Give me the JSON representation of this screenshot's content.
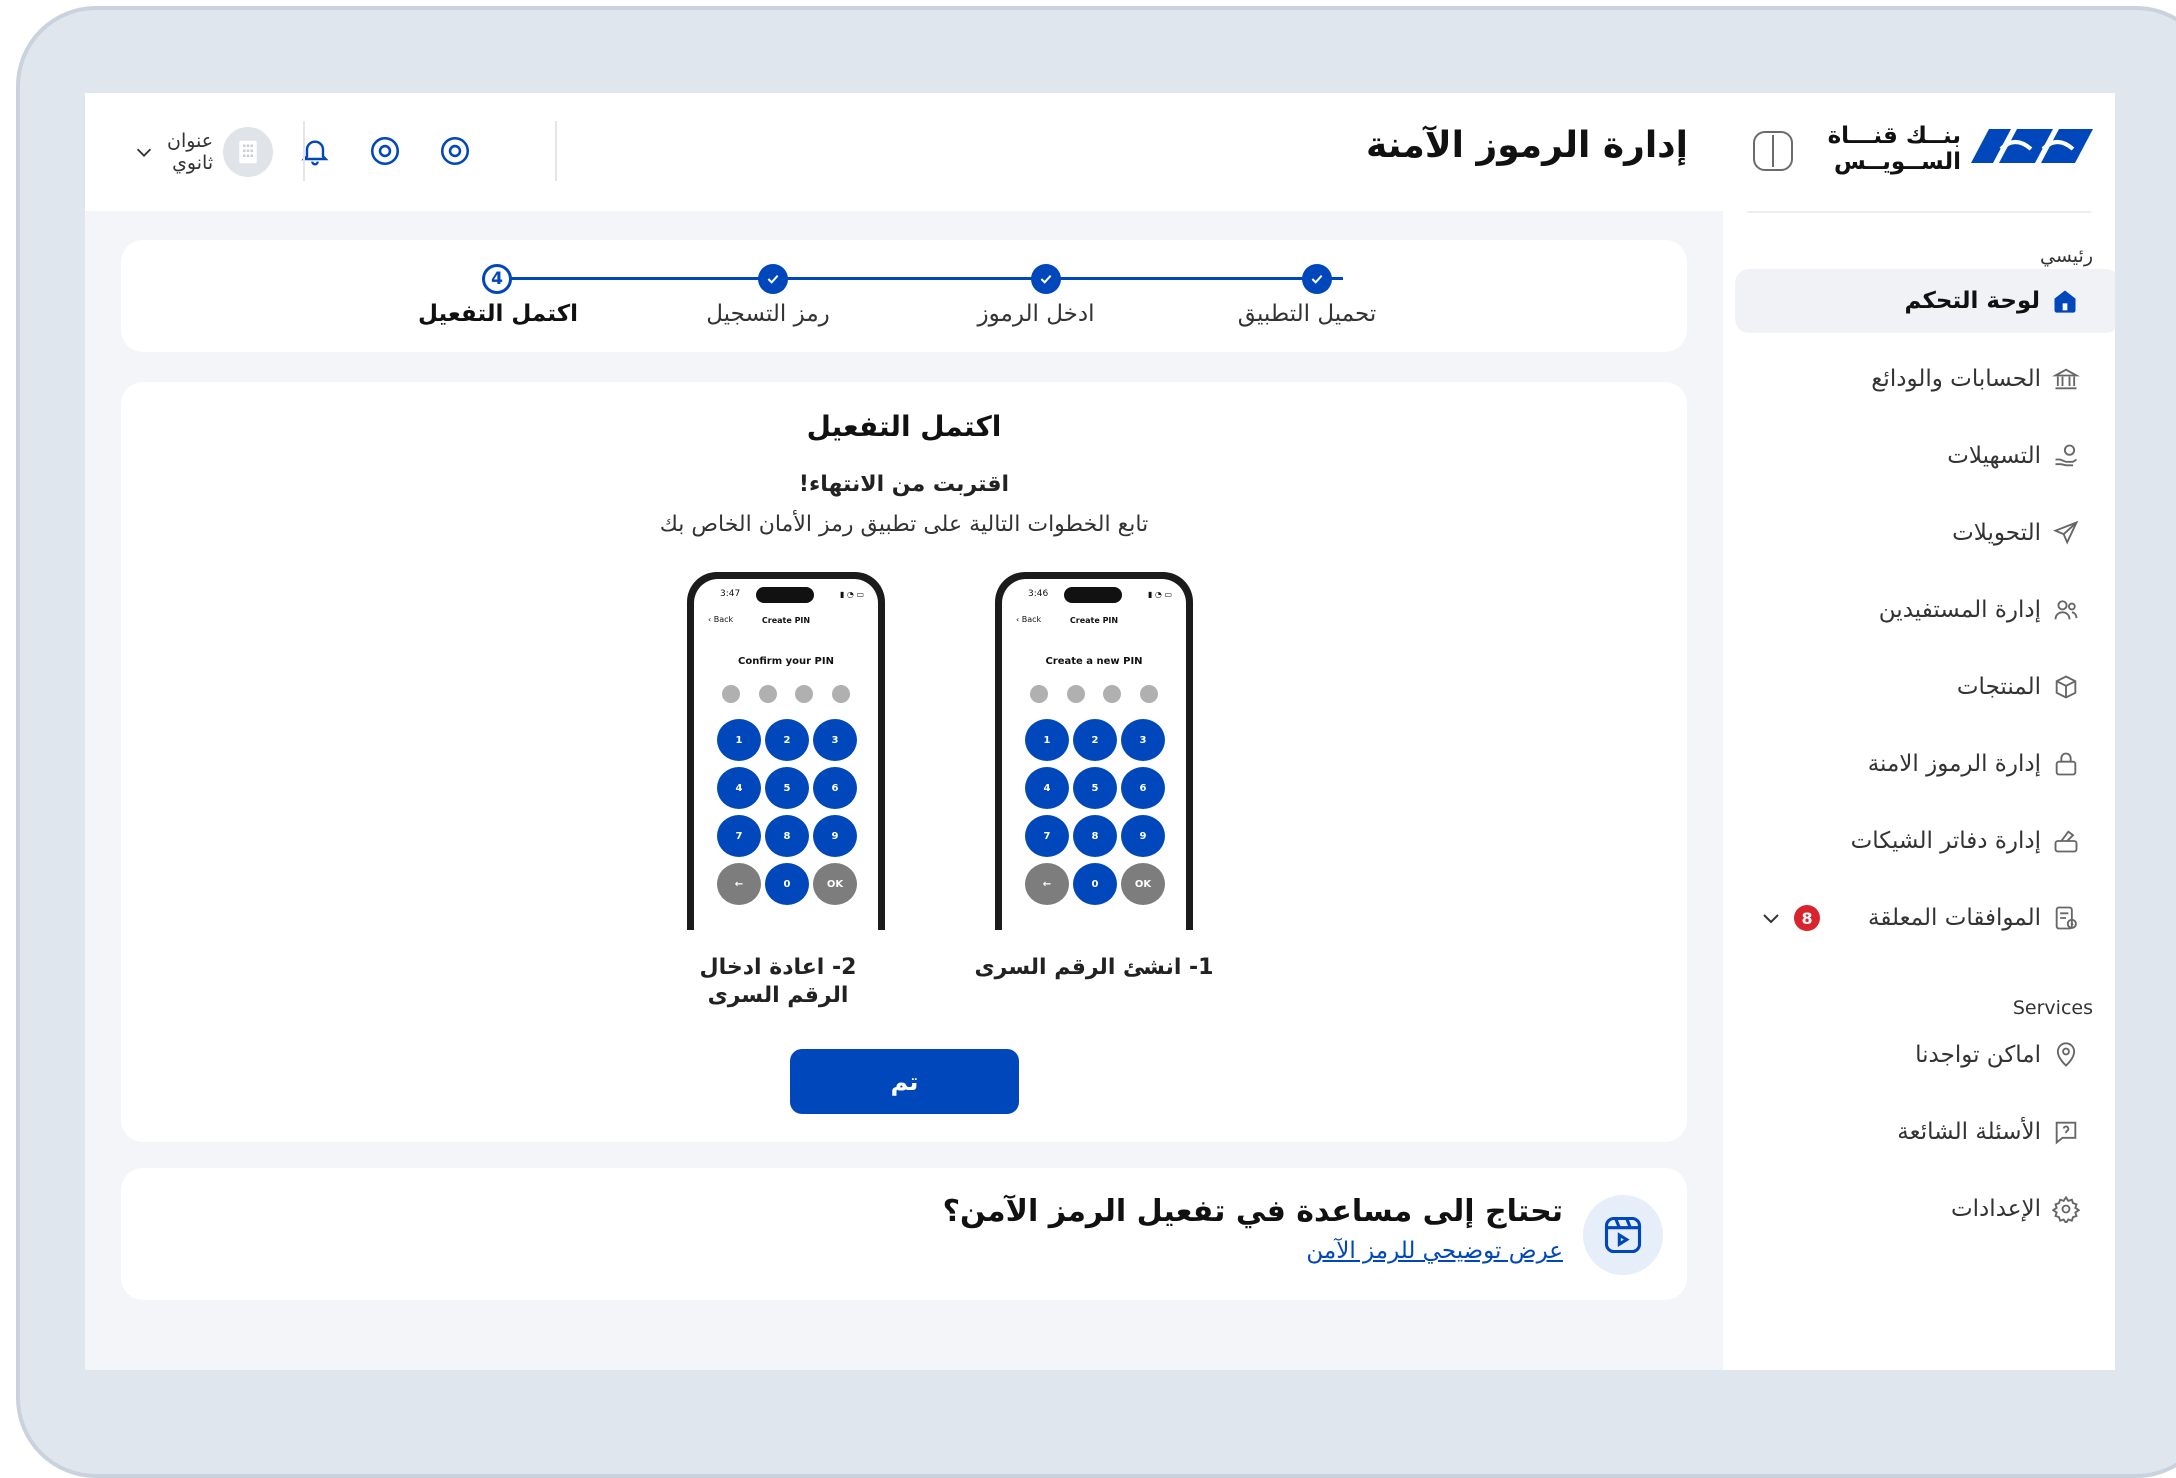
{
  "colors": {
    "primary": "#0047bb",
    "badge": "#d9232d",
    "background": "#f4f5f8",
    "frame": "#dfe6ee"
  },
  "header": {
    "brand_line1": "بنــك قنـــاة",
    "brand_line2": "الســويــس",
    "page_title": "إدارة الرموز الآمنة",
    "user_line1": "عنوان",
    "user_line2": "ثانوي",
    "icons": [
      "bell-icon",
      "eye-icon",
      "eye-icon"
    ]
  },
  "sidebar": {
    "section_main": "رئيسي",
    "items": [
      {
        "label": "لوحة التحكم",
        "icon": "home-icon"
      },
      {
        "label": "الحسابات والودائع",
        "icon": "bank-icon"
      },
      {
        "label": "التسهيلات",
        "icon": "hand-coin-icon"
      },
      {
        "label": "التحويلات",
        "icon": "send-icon"
      },
      {
        "label": "إدارة المستفيدين",
        "icon": "users-icon"
      },
      {
        "label": "المنتجات",
        "icon": "box-icon"
      },
      {
        "label": "إدارة الرموز الامنة",
        "icon": "lock-icon"
      },
      {
        "label": "إدارة دفاتر الشيكات",
        "icon": "checkbook-icon"
      },
      {
        "label": "الموافقات المعلقة",
        "icon": "approval-icon",
        "badge": "8"
      }
    ],
    "section_services": "Services",
    "services": [
      {
        "label": "اماكن تواجدنا",
        "icon": "location-icon"
      },
      {
        "label": "الأسئلة الشائعة",
        "icon": "faq-icon"
      },
      {
        "label": "الإعدادات",
        "icon": "settings-icon"
      }
    ]
  },
  "stepper": {
    "steps": [
      {
        "label": "تحميل التطبيق",
        "state": "done"
      },
      {
        "label": "ادخل الرموز",
        "state": "done"
      },
      {
        "label": "رمز التسجيل",
        "state": "done"
      },
      {
        "label": "اكتمل التفعيل",
        "state": "current",
        "number": "4"
      }
    ]
  },
  "main": {
    "title": "اكتمل التفعيل",
    "subtitle": "اقتربت من الانتهاء!",
    "description": "تابع الخطوات التالية على تطبيق رمز الأمان الخاص بك",
    "phones": [
      {
        "caption": "1- انشئ الرقم السرى",
        "time": "3:46",
        "back": "Back",
        "screen_title": "Create PIN",
        "prompt": "Create a new PIN",
        "keys": [
          "1",
          "2",
          "3",
          "4",
          "5",
          "6",
          "7",
          "8",
          "9",
          "←",
          "0",
          "OK"
        ]
      },
      {
        "caption": "2- اعادة ادخال الرقم السرى",
        "time": "3:47",
        "back": "Back",
        "screen_title": "Create PIN",
        "prompt": "Confirm your PIN",
        "keys": [
          "1",
          "2",
          "3",
          "4",
          "5",
          "6",
          "7",
          "8",
          "9",
          "←",
          "0",
          "OK"
        ]
      }
    ],
    "done_button": "تم"
  },
  "help": {
    "title": "تحتاج إلى مساعدة في تفعيل الرمز الآمن؟",
    "link": "عرض توضيحي للرمز الآمن",
    "icon": "video-play-icon"
  }
}
